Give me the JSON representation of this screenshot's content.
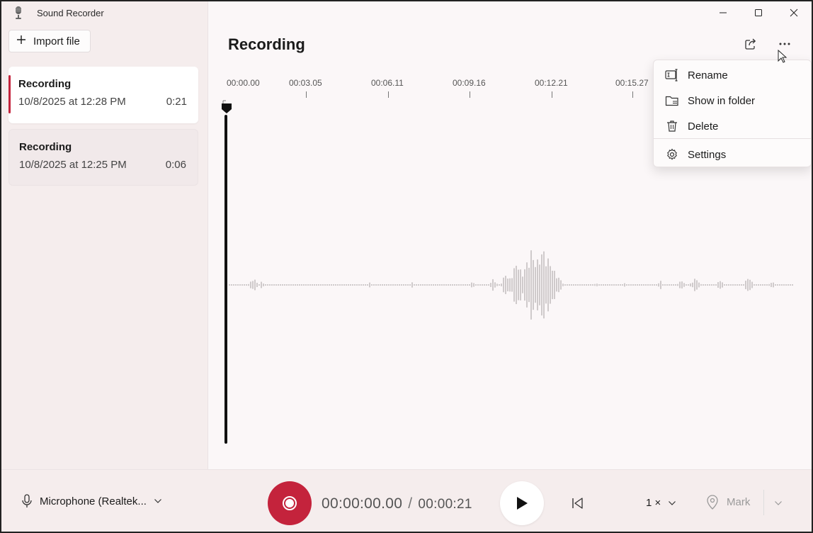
{
  "app": {
    "title": "Sound Recorder"
  },
  "sidebar": {
    "import_label": "Import file",
    "recordings": [
      {
        "name": "Recording",
        "date": "10/8/2025 at 12:28 PM",
        "duration": "0:21"
      },
      {
        "name": "Recording",
        "date": "10/8/2025 at 12:25 PM",
        "duration": "0:06"
      }
    ]
  },
  "main": {
    "title": "Recording",
    "timeline": {
      "ticks": [
        "00:00.00",
        "00:03.05",
        "00:06.11",
        "00:09.16",
        "00:12.21",
        "00:15.27"
      ]
    }
  },
  "menu": {
    "rename": "Rename",
    "show_in_folder": "Show in folder",
    "delete": "Delete",
    "settings": "Settings"
  },
  "bottom": {
    "microphone": "Microphone (Realtek...",
    "current_time": "00:00:00.00",
    "separator": "/",
    "total_time": "00:00:21",
    "speed": "1 ×",
    "mark": "Mark"
  },
  "colors": {
    "accent": "#c4233c",
    "background": "#fbf7f8",
    "sidebar": "#f5eded"
  }
}
